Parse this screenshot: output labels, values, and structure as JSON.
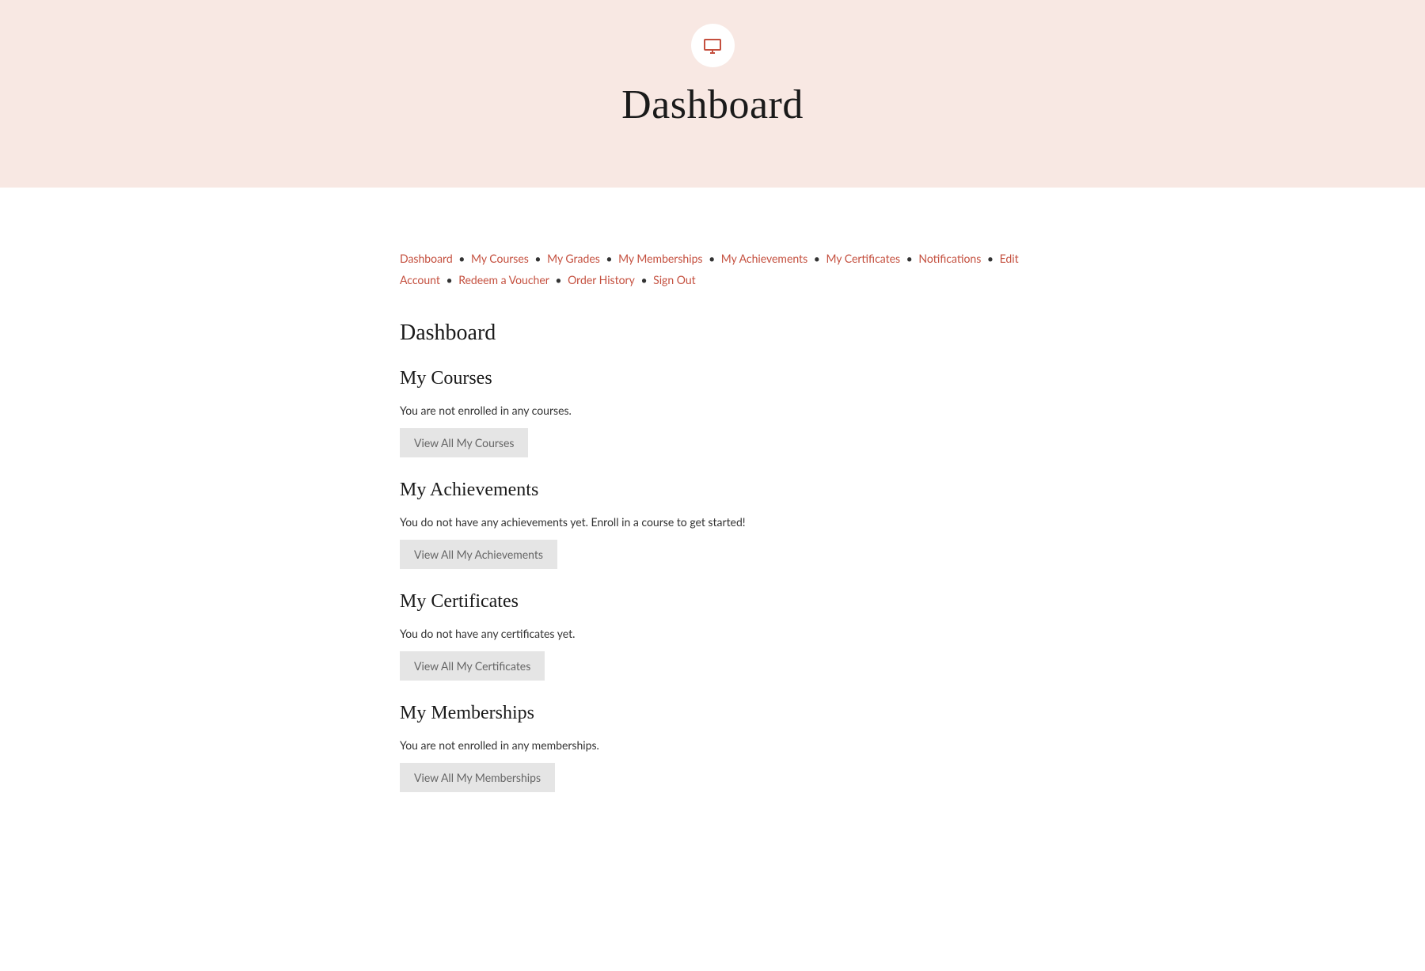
{
  "hero": {
    "title": "Dashboard"
  },
  "nav": {
    "items": [
      "Dashboard",
      "My Courses",
      "My Grades",
      "My Memberships",
      "My Achievements",
      "My Certificates",
      "Notifications",
      "Edit Account",
      "Redeem a Voucher",
      "Order History",
      "Sign Out"
    ]
  },
  "main": {
    "title": "Dashboard",
    "sections": [
      {
        "heading": "My Courses",
        "text": "You are not enrolled in any courses.",
        "button": "View All My Courses"
      },
      {
        "heading": "My Achievements",
        "text": "You do not have any achievements yet. Enroll in a course to get started!",
        "button": "View All My Achievements"
      },
      {
        "heading": "My Certificates",
        "text": "You do not have any certificates yet.",
        "button": "View All My Certificates"
      },
      {
        "heading": "My Memberships",
        "text": "You are not enrolled in any memberships.",
        "button": "View All My Memberships"
      }
    ]
  }
}
